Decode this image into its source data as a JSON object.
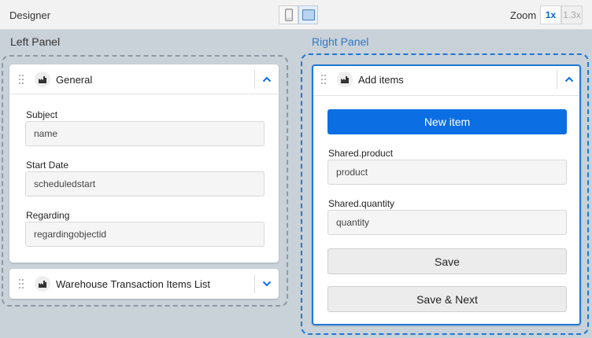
{
  "topbar": {
    "title": "Designer",
    "device_options": [
      {
        "icon": "mobile-device-icon",
        "active": false
      },
      {
        "icon": "desktop-device-icon",
        "active": true
      }
    ],
    "zoom_label": "Zoom",
    "zoom_options": [
      {
        "label": "1x",
        "active": true
      },
      {
        "label": "1.3x",
        "active": false
      }
    ]
  },
  "left_panel": {
    "label": "Left Panel",
    "cards": [
      {
        "title": "General",
        "icon": "factory-icon",
        "expanded": true,
        "fields": [
          {
            "label": "Subject",
            "value": "name"
          },
          {
            "label": "Start Date",
            "value": "scheduledstart"
          },
          {
            "label": "Regarding",
            "value": "regardingobjectid"
          }
        ]
      },
      {
        "title": "Warehouse Transaction Items List",
        "icon": "factory-icon",
        "expanded": false
      }
    ]
  },
  "right_panel": {
    "label": "Right Panel",
    "card": {
      "title": "Add items",
      "icon": "factory-icon",
      "expanded": true,
      "new_item_label": "New item",
      "fields": [
        {
          "label": "Shared.product",
          "value": "product"
        },
        {
          "label": "Shared.quantity",
          "value": "quantity"
        }
      ],
      "save_label": "Save",
      "save_next_label": "Save & Next"
    }
  },
  "colors": {
    "accent": "#0b6fe3",
    "right_panel_label": "#2f79c6",
    "canvas_background": "#c9d1d9"
  }
}
